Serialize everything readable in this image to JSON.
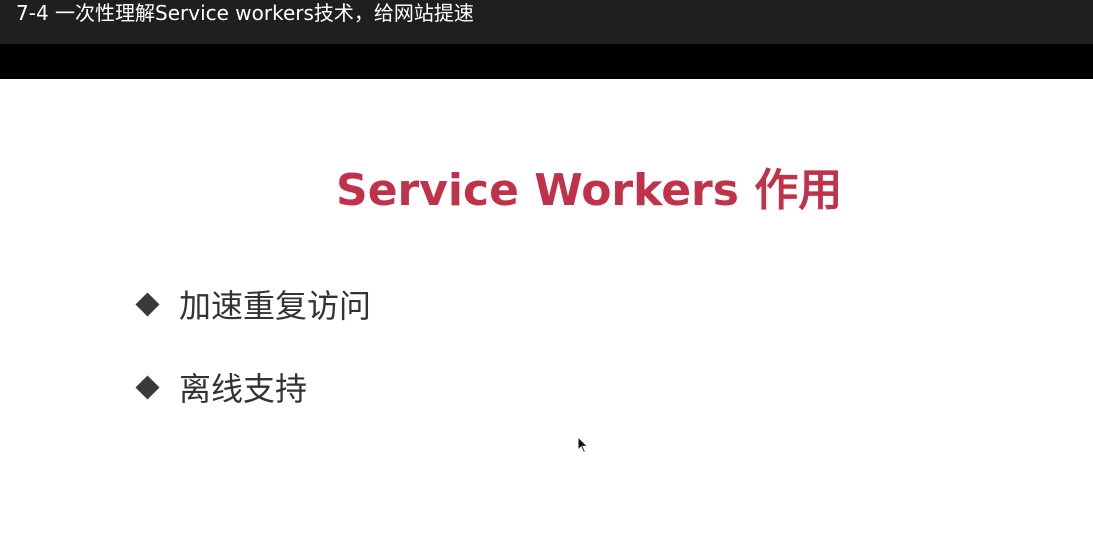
{
  "window": {
    "title": "7-4 一次性理解Service workers技术，给网站提速"
  },
  "slide": {
    "heading": "Service Workers 作用",
    "bullets": [
      {
        "icon": "diamond-bullet-icon",
        "label": "加速重复访问"
      },
      {
        "icon": "diamond-bullet-icon",
        "label": "离线支持"
      }
    ]
  },
  "colors": {
    "title_bar_bg": "#1e1f20",
    "band_bg": "#000000",
    "heading": "#c0314a",
    "bullet_text": "#333333",
    "diamond": "#3a3a3a"
  },
  "cursor": {
    "icon": "mouse-pointer-icon"
  }
}
